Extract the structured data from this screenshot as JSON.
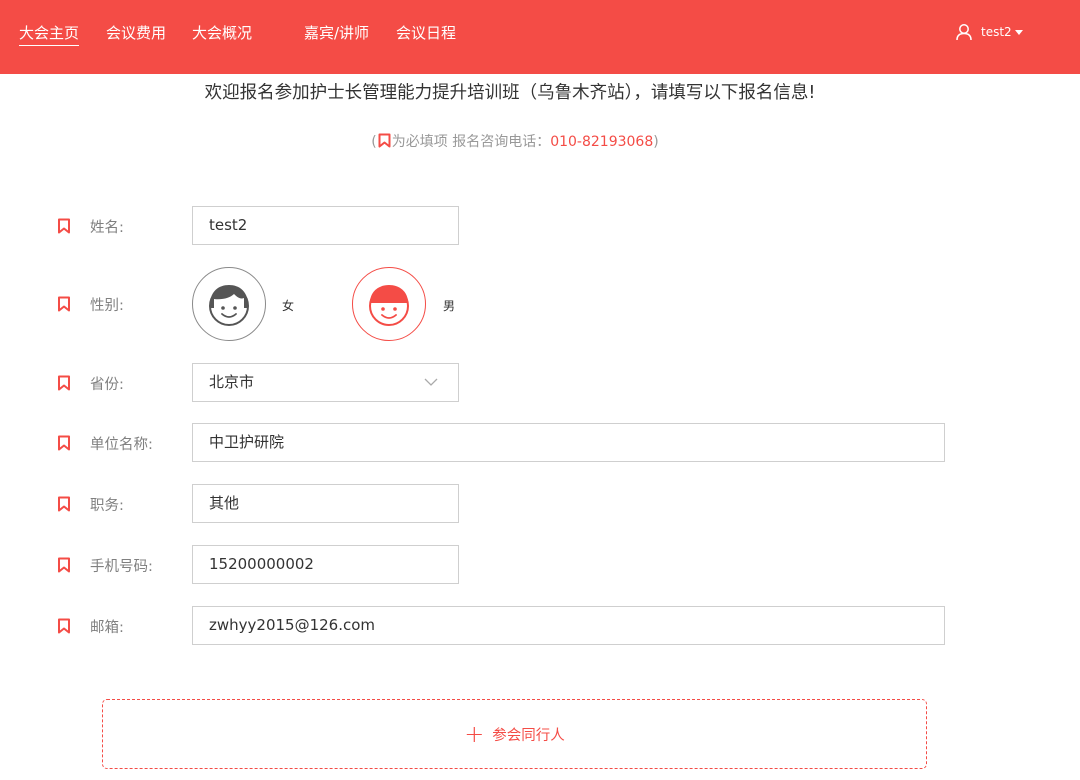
{
  "nav": {
    "items": [
      {
        "label": "大会主页",
        "active": true
      },
      {
        "label": "会议费用",
        "active": false
      },
      {
        "label": "大会概况",
        "active": false
      },
      {
        "label": "嘉宾/讲师",
        "active": false
      },
      {
        "label": "会议日程",
        "active": false
      }
    ],
    "user": {
      "name": "test2",
      "icon": "user-icon"
    }
  },
  "header": {
    "welcome": "欢迎报名参加护士长管理能力提升培训班（乌鲁木齐站），请填写以下报名信息!",
    "hint_open": "(",
    "hint_required": "为必填项",
    "hint_consult": "报名咨询电话：",
    "hint_phone": "010-82193068",
    "hint_close": ")"
  },
  "form": {
    "name": {
      "label": "姓名:",
      "value": "test2"
    },
    "gender": {
      "label": "性别:",
      "female": "女",
      "male": "男",
      "selected": "男"
    },
    "province": {
      "label": "省份:",
      "value": "北京市"
    },
    "org": {
      "label": "单位名称:",
      "value": "中卫护研院"
    },
    "position": {
      "label": "职务:",
      "value": "其他"
    },
    "phone": {
      "label": "手机号码:",
      "value": "15200000002"
    },
    "email": {
      "label": "邮箱:",
      "value": "zwhyy2015@126.com"
    }
  },
  "companion_button": {
    "label": "参会同行人",
    "icon": "plus-icon"
  },
  "colors": {
    "accent": "#f44c46",
    "muted": "#999999",
    "border": "#cfcfcf"
  }
}
